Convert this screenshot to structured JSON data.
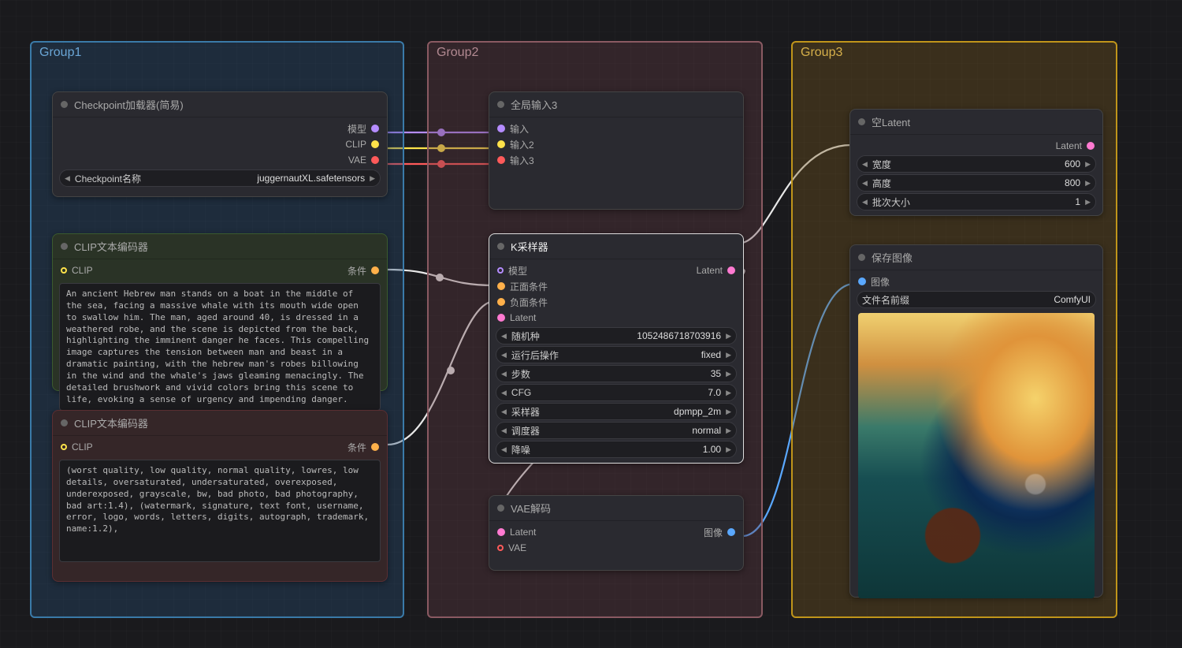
{
  "groups": {
    "g1": "Group1",
    "g2": "Group2",
    "g3": "Group3"
  },
  "checkpoint": {
    "title": "Checkpoint加载器(简易)",
    "out_model": "模型",
    "out_clip": "CLIP",
    "out_vae": "VAE",
    "param_name": "Checkpoint名称",
    "param_value": "juggernautXL.safetensors"
  },
  "clip_pos": {
    "title": "CLIP文本编码器",
    "in_clip": "CLIP",
    "out_cond": "条件",
    "text": "An ancient Hebrew man stands on a boat in the middle of the sea, facing a massive whale with its mouth wide open to swallow him. The man, aged around 40, is dressed in a weathered robe, and the scene is depicted from the back, highlighting the imminent danger he faces. This compelling image captures the tension between man and beast in a dramatic painting, with the hebrew man's robes billowing in the wind and the whale's jaws gleaming menacingly. The detailed brushwork and vivid colors bring this scene to life, evoking a sense of urgency and impending danger."
  },
  "clip_neg": {
    "title": "CLIP文本编码器",
    "in_clip": "CLIP",
    "out_cond": "条件",
    "text": "(worst quality, low quality, normal quality, lowres, low details, oversaturated, undersaturated, overexposed, underexposed, grayscale, bw, bad photo, bad photography, bad art:1.4), (watermark, signature, text font, username, error, logo, words, letters, digits, autograph, trademark, name:1.2),"
  },
  "global": {
    "title": "全局输入3",
    "in1": "输入",
    "in2": "输入2",
    "in3": "输入3"
  },
  "ksampler": {
    "title": "K采样器",
    "in_model": "模型",
    "in_pos": "正面条件",
    "in_neg": "负面条件",
    "in_latent": "Latent",
    "out_latent": "Latent",
    "params": [
      {
        "k": "随机种",
        "v": "1052486718703916"
      },
      {
        "k": "运行后操作",
        "v": "fixed"
      },
      {
        "k": "步数",
        "v": "35"
      },
      {
        "k": "CFG",
        "v": "7.0"
      },
      {
        "k": "采样器",
        "v": "dpmpp_2m"
      },
      {
        "k": "调度器",
        "v": "normal"
      },
      {
        "k": "降噪",
        "v": "1.00"
      }
    ]
  },
  "vae": {
    "title": "VAE解码",
    "in_latent": "Latent",
    "in_vae": "VAE",
    "out_image": "图像"
  },
  "latent": {
    "title": "空Latent",
    "out_latent": "Latent",
    "params": [
      {
        "k": "宽度",
        "v": "600"
      },
      {
        "k": "高度",
        "v": "800"
      },
      {
        "k": "批次大小",
        "v": "1"
      }
    ]
  },
  "save": {
    "title": "保存图像",
    "in_image": "图像",
    "prefix_k": "文件名前缀",
    "prefix_v": "ComfyUI"
  },
  "colors": {
    "model": "#b58cff",
    "clip": "#ffe24a",
    "vae": "#ff5a5a",
    "cond": "#ffb04a",
    "latent": "#ff7ad1",
    "image": "#5aa8ff",
    "white": "#e8e8e8"
  }
}
